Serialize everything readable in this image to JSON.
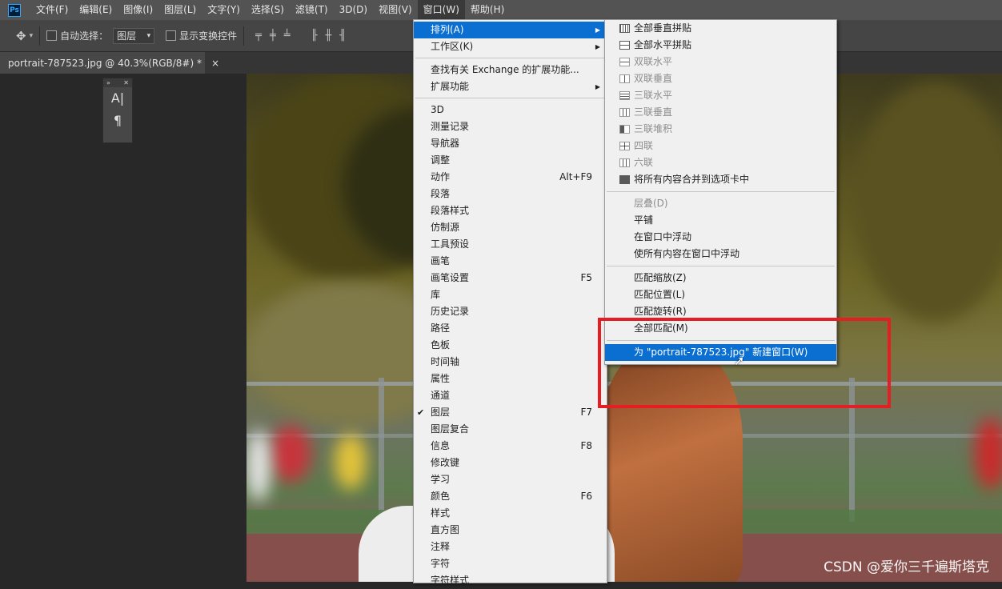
{
  "menubar": {
    "logo": "Ps",
    "items": [
      "文件(F)",
      "编辑(E)",
      "图像(I)",
      "图层(L)",
      "文字(Y)",
      "选择(S)",
      "滤镜(T)",
      "3D(D)",
      "视图(V)",
      "窗口(W)",
      "帮助(H)"
    ],
    "active_item": "窗口(W)"
  },
  "options_bar": {
    "move_tool_icon": "move-icon",
    "auto_select_label": "自动选择：",
    "auto_select_value": "图层",
    "show_transform_label": "显示变换控件"
  },
  "document_tab": {
    "title": "portrait-787523.jpg @ 40.3%(RGB/8#) *",
    "close": "×"
  },
  "mini_panel": {
    "icons": [
      "A|",
      "¶"
    ]
  },
  "window_menu": {
    "items": [
      {
        "label": "排列(A)",
        "submenu": true,
        "highlighted": true
      },
      {
        "label": "工作区(K)",
        "submenu": true
      },
      {
        "separator": true
      },
      {
        "label": "查找有关 Exchange 的扩展功能..."
      },
      {
        "label": "扩展功能",
        "submenu": true
      },
      {
        "separator": true
      },
      {
        "label": "3D"
      },
      {
        "label": "测量记录"
      },
      {
        "label": "导航器"
      },
      {
        "label": "调整"
      },
      {
        "label": "动作",
        "shortcut": "Alt+F9"
      },
      {
        "label": "段落"
      },
      {
        "label": "段落样式"
      },
      {
        "label": "仿制源"
      },
      {
        "label": "工具预设"
      },
      {
        "label": "画笔"
      },
      {
        "label": "画笔设置",
        "shortcut": "F5"
      },
      {
        "label": "库"
      },
      {
        "label": "历史记录"
      },
      {
        "label": "路径"
      },
      {
        "label": "色板"
      },
      {
        "label": "时间轴"
      },
      {
        "label": "属性"
      },
      {
        "label": "通道"
      },
      {
        "label": "图层",
        "shortcut": "F7",
        "checked": true
      },
      {
        "label": "图层复合"
      },
      {
        "label": "信息",
        "shortcut": "F8"
      },
      {
        "label": "修改键"
      },
      {
        "label": "学习"
      },
      {
        "label": "颜色",
        "shortcut": "F6"
      },
      {
        "label": "样式"
      },
      {
        "label": "直方图"
      },
      {
        "label": "注释"
      },
      {
        "label": "字符"
      },
      {
        "label": "字符样式"
      }
    ]
  },
  "arrange_menu": {
    "items": [
      {
        "label": "全部垂直拼贴",
        "icon": "v4"
      },
      {
        "label": "全部水平拼贴",
        "icon": "h2"
      },
      {
        "label": "双联水平",
        "icon": "h2",
        "disabled": true
      },
      {
        "label": "双联垂直",
        "icon": "v2",
        "disabled": true
      },
      {
        "label": "三联水平",
        "icon": "h3",
        "disabled": true
      },
      {
        "label": "三联垂直",
        "icon": "v3",
        "disabled": true
      },
      {
        "label": "三联堆积",
        "icon": "stack",
        "disabled": true
      },
      {
        "label": "四联",
        "icon": "q4",
        "disabled": true
      },
      {
        "label": "六联",
        "icon": "q6",
        "disabled": true
      },
      {
        "label": "将所有内容合并到选项卡中",
        "icon": "one"
      },
      {
        "separator": true
      },
      {
        "label": "层叠(D)",
        "disabled": true
      },
      {
        "label": "平铺"
      },
      {
        "label": "在窗口中浮动"
      },
      {
        "label": "使所有内容在窗口中浮动"
      },
      {
        "separator": true
      },
      {
        "label": "匹配缩放(Z)"
      },
      {
        "label": "匹配位置(L)"
      },
      {
        "label": "匹配旋转(R)"
      },
      {
        "label": "全部匹配(M)"
      },
      {
        "separator": true
      },
      {
        "label": "为 \"portrait-787523.jpg\" 新建窗口(W)",
        "highlighted": true
      }
    ]
  },
  "watermark": "CSDN @爱你三千遍斯塔克"
}
